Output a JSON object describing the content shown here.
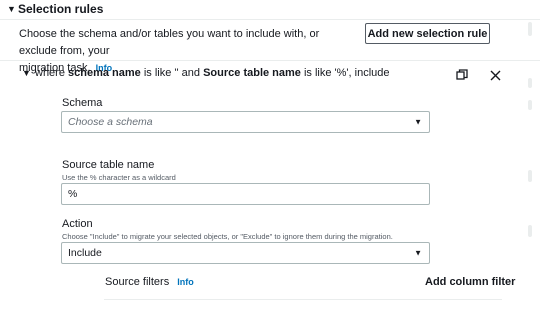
{
  "section": {
    "title": "Selection rules",
    "description_line1": "Choose the schema and/or tables you want to include with, or exclude from, your",
    "description_line2": "migration task.",
    "info": "Info",
    "add_rule_button": "Add new selection rule"
  },
  "rule": {
    "prefix": "where",
    "schema_bold": "schema name",
    "mid1": "is like '' and",
    "table_bold": "Source table name",
    "mid2": "is like '%', include"
  },
  "schema": {
    "label": "Schema",
    "placeholder": "Choose a schema"
  },
  "source_table": {
    "label": "Source table name",
    "hint": "Use the % character as a wildcard",
    "value": "%"
  },
  "action": {
    "label": "Action",
    "hint": "Choose \"Include\" to migrate your selected objects, or \"Exclude\" to ignore them during the migration.",
    "value": "Include"
  },
  "source_filters": {
    "label": "Source filters",
    "info": "Info",
    "add_column_filter": "Add column filter"
  },
  "icons": {
    "caret": "▼",
    "dropdown": "▼",
    "copy": "copy-icon",
    "close": "close-icon"
  }
}
